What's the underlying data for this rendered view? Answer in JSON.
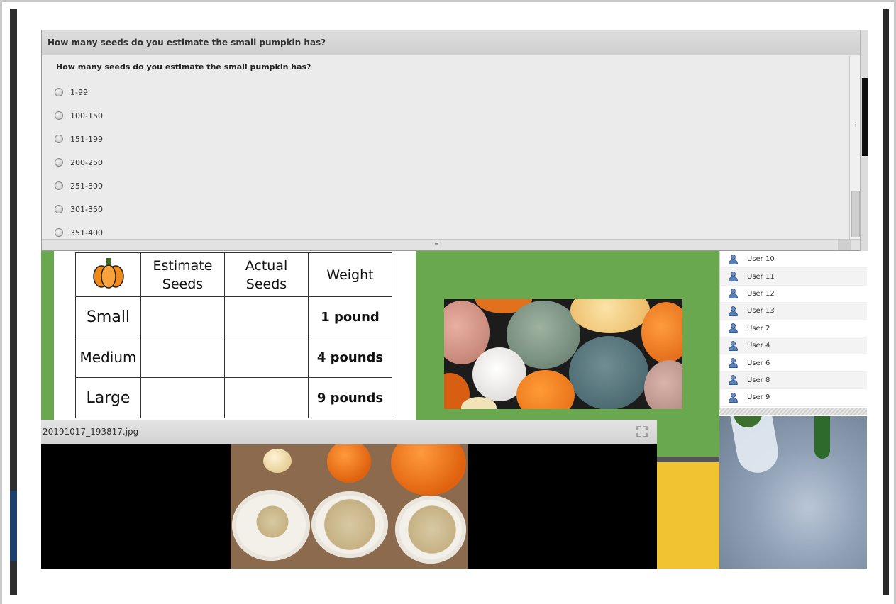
{
  "poll": {
    "title": "How many seeds do you estimate the small pumpkin has?",
    "question": "How many seeds do you estimate the small pumpkin has?",
    "options": [
      "1-99",
      "100-150",
      "151-199",
      "200-250",
      "251-300",
      "301-350",
      "351-400"
    ]
  },
  "slide": {
    "table": {
      "icon": "pumpkin-icon",
      "headers": [
        "Estimate Seeds",
        "Actual Seeds",
        "Weight"
      ],
      "rows": [
        {
          "size": "Small",
          "estimate": "",
          "actual": "",
          "weight": "1 pound"
        },
        {
          "size": "Medium",
          "estimate": "",
          "actual": "",
          "weight": "4 pounds"
        },
        {
          "size": "Large",
          "estimate": "",
          "actual": "",
          "weight": "9 pounds"
        }
      ]
    },
    "colors": {
      "green": "#6aa84f",
      "yellow": "#f1c232"
    }
  },
  "users": [
    "User 10",
    "User 11",
    "User 12",
    "User 13",
    "User 2",
    "User 4",
    "User 6",
    "User 8",
    "User 9"
  ],
  "viewer": {
    "filename": "20191017_193817.jpg",
    "expand_icon": "expand-icon"
  }
}
